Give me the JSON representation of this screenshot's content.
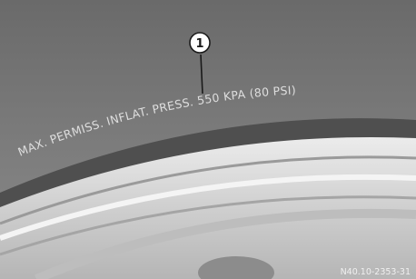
{
  "figure": {
    "sidewall_marking": "MAX. PERMISS. INFLAT. PRESS.   550 KPA (80 PSI)",
    "callout_number": "1",
    "figure_id": "N40.10-2353-31"
  },
  "colors": {
    "tire_rubber": "#7a7a7a",
    "tire_shoulder": "#5f5f5f",
    "rim_light": "#d9d9d9",
    "rim_shadow": "#a8a8a8",
    "marking_text": "#dedede"
  }
}
